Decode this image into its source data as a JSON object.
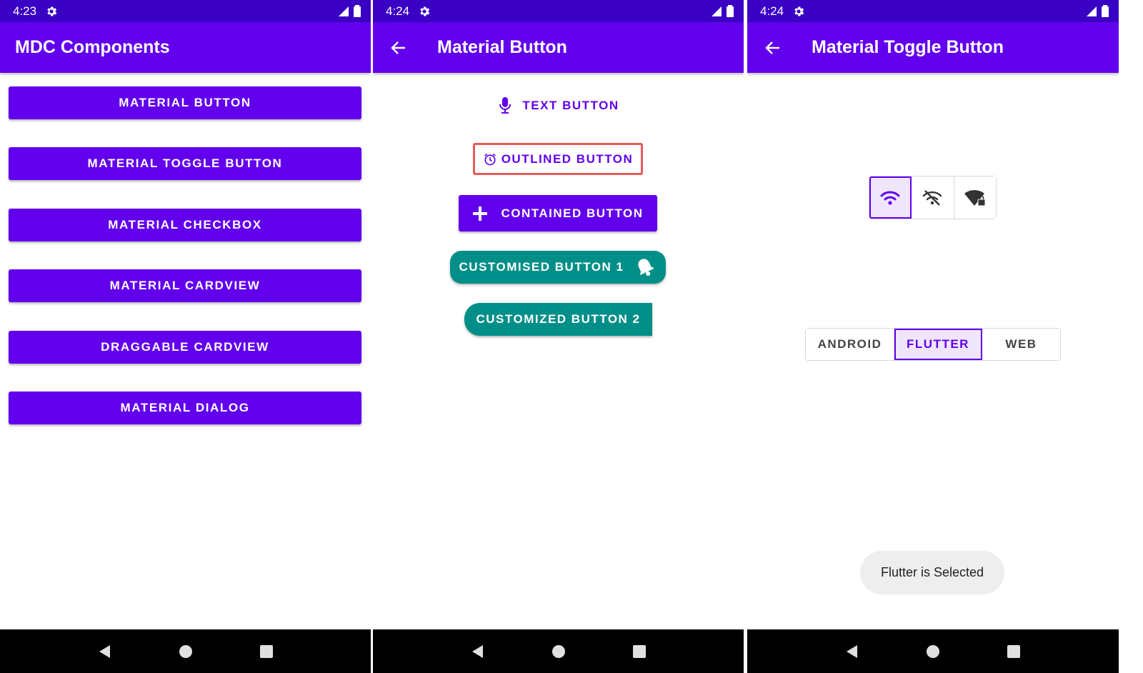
{
  "colors": {
    "primary": "#6200ee",
    "primary_dark": "#3a00c4",
    "secondary": "#008f88",
    "outline_accent": "#e65a5a",
    "selected_bg": "#efe6fd"
  },
  "screen1": {
    "status": {
      "time": "4:23"
    },
    "appbar": {
      "title": "MDC Components"
    },
    "menu": [
      {
        "label": "MATERIAL BUTTON"
      },
      {
        "label": "MATERIAL TOGGLE BUTTON"
      },
      {
        "label": "MATERIAL CHECKBOX"
      },
      {
        "label": "MATERIAL CARDVIEW"
      },
      {
        "label": "DRAGGABLE CARDVIEW"
      },
      {
        "label": "MATERIAL DIALOG"
      }
    ]
  },
  "screen2": {
    "status": {
      "time": "4:24"
    },
    "appbar": {
      "title": "Material Button"
    },
    "buttons": {
      "text": {
        "label": "TEXT BUTTON",
        "icon": "mic-icon"
      },
      "outlined": {
        "label": "OUTLINED BUTTON",
        "icon": "alarm-icon"
      },
      "contained": {
        "label": "CONTAINED BUTTON",
        "icon": "plus-icon"
      },
      "custom1": {
        "label": "CUSTOMISED BUTTON 1",
        "icon": "bell-icon"
      },
      "custom2": {
        "label": "CUSTOMIZED BUTTON 2"
      }
    }
  },
  "screen3": {
    "status": {
      "time": "4:24"
    },
    "appbar": {
      "title": "Material Toggle Button"
    },
    "icon_toggles": [
      {
        "icon": "wifi-icon",
        "selected": true
      },
      {
        "icon": "wifi-off-icon",
        "selected": false
      },
      {
        "icon": "wifi-lock-icon",
        "selected": false
      }
    ],
    "text_toggles": [
      {
        "label": "ANDROID",
        "selected": false
      },
      {
        "label": "FLUTTER",
        "selected": true
      },
      {
        "label": "WEB",
        "selected": false
      }
    ],
    "toast": "Flutter is Selected"
  }
}
